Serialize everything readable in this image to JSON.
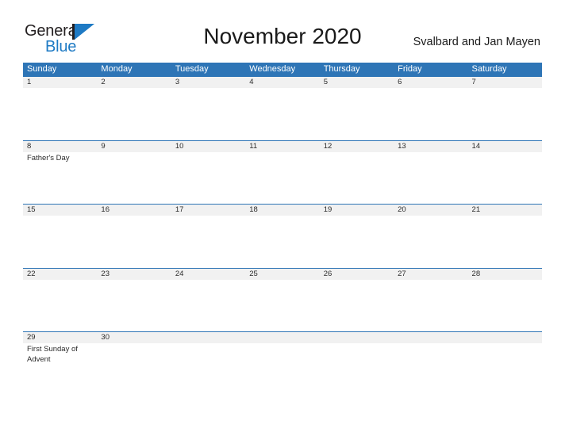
{
  "brand": {
    "name_part1": "General",
    "name_part2": "Blue",
    "mark": "pennant-triangle"
  },
  "header": {
    "title": "November 2020",
    "region": "Svalbard and Jan Mayen"
  },
  "colors": {
    "header_blue": "#2e75b6",
    "band_gray": "#f1f1f1",
    "brand_blue": "#1e7ac4",
    "text_dark": "#231f20"
  },
  "calendar": {
    "day_names": [
      "Sunday",
      "Monday",
      "Tuesday",
      "Wednesday",
      "Thursday",
      "Friday",
      "Saturday"
    ],
    "weeks": [
      [
        {
          "day": "1",
          "event": ""
        },
        {
          "day": "2",
          "event": ""
        },
        {
          "day": "3",
          "event": ""
        },
        {
          "day": "4",
          "event": ""
        },
        {
          "day": "5",
          "event": ""
        },
        {
          "day": "6",
          "event": ""
        },
        {
          "day": "7",
          "event": ""
        }
      ],
      [
        {
          "day": "8",
          "event": "Father's Day"
        },
        {
          "day": "9",
          "event": ""
        },
        {
          "day": "10",
          "event": ""
        },
        {
          "day": "11",
          "event": ""
        },
        {
          "day": "12",
          "event": ""
        },
        {
          "day": "13",
          "event": ""
        },
        {
          "day": "14",
          "event": ""
        }
      ],
      [
        {
          "day": "15",
          "event": ""
        },
        {
          "day": "16",
          "event": ""
        },
        {
          "day": "17",
          "event": ""
        },
        {
          "day": "18",
          "event": ""
        },
        {
          "day": "19",
          "event": ""
        },
        {
          "day": "20",
          "event": ""
        },
        {
          "day": "21",
          "event": ""
        }
      ],
      [
        {
          "day": "22",
          "event": ""
        },
        {
          "day": "23",
          "event": ""
        },
        {
          "day": "24",
          "event": ""
        },
        {
          "day": "25",
          "event": ""
        },
        {
          "day": "26",
          "event": ""
        },
        {
          "day": "27",
          "event": ""
        },
        {
          "day": "28",
          "event": ""
        }
      ],
      [
        {
          "day": "29",
          "event": "First Sunday of Advent"
        },
        {
          "day": "30",
          "event": ""
        },
        {
          "day": "",
          "event": ""
        },
        {
          "day": "",
          "event": ""
        },
        {
          "day": "",
          "event": ""
        },
        {
          "day": "",
          "event": ""
        },
        {
          "day": "",
          "event": ""
        }
      ]
    ]
  }
}
